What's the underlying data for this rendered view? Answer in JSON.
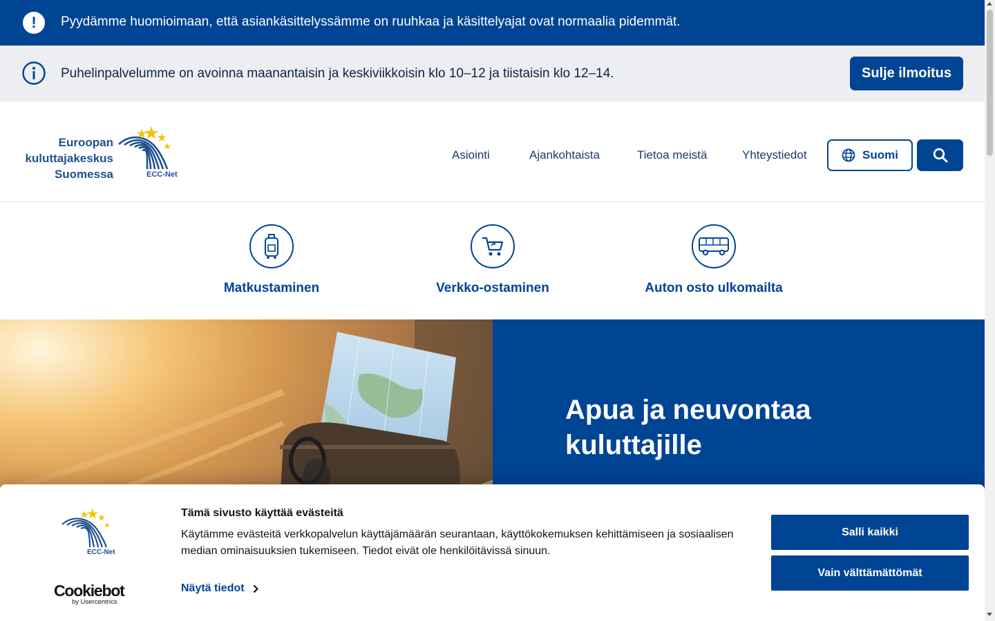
{
  "alerts": {
    "urgent_text": "Pyydämme huomioimaan, että asiankäsittelyssämme on ruuhkaa ja käsittelyajat ovat normaalia pidemmät.",
    "urgent_icon": "exclamation-icon",
    "info_text": "Puhelinpalvelumme on avoinna maanantaisin ja keskiviikkoisin klo 10–12 ja tiistaisin klo 12–14.",
    "info_icon": "info-icon",
    "close_label": "Sulje ilmoitus"
  },
  "logo": {
    "line1": "Euroopan",
    "line2": "kuluttajakeskus",
    "line3": "Suomessa",
    "network": "ECC-Net"
  },
  "nav": {
    "items": [
      "Asiointi",
      "Ajankohtaista",
      "Tietoa meistä",
      "Yhteystiedot"
    ],
    "language_label": "Suomi",
    "language_icon": "globe-icon",
    "search_icon": "search-icon"
  },
  "categories": [
    {
      "label": "Matkustaminen",
      "icon": "suitcase-icon"
    },
    {
      "label": "Verkko-ostaminen",
      "icon": "shopping-cart-icon"
    },
    {
      "label": "Auton osto ulkomailta",
      "icon": "bus-icon"
    }
  ],
  "hero": {
    "title": "Apua ja neuvontaa kuluttajille",
    "image": "map-in-bag-photo"
  },
  "cookie": {
    "title": "Tämä sivusto käyttää evästeitä",
    "text": "Käytämme evästeitä verkkopalvelun käyttäjämäärän seurantaan, käyttökokemuksen kehittämiseen ja sosiaalisen median ominaisuuksien tukemiseen. Tiedot eivät ole henkilöitävissä sinuun.",
    "details_label": "Näytä tiedot",
    "allow_all_label": "Salli kaikki",
    "necessary_label": "Vain välttämättömät",
    "brand": "Cookiebot",
    "brand_sub": "by Usercentrics",
    "logo_network": "ECC-Net"
  },
  "colors": {
    "primary": "#004494",
    "info_bg": "#eceef1",
    "star": "#f5c200"
  }
}
